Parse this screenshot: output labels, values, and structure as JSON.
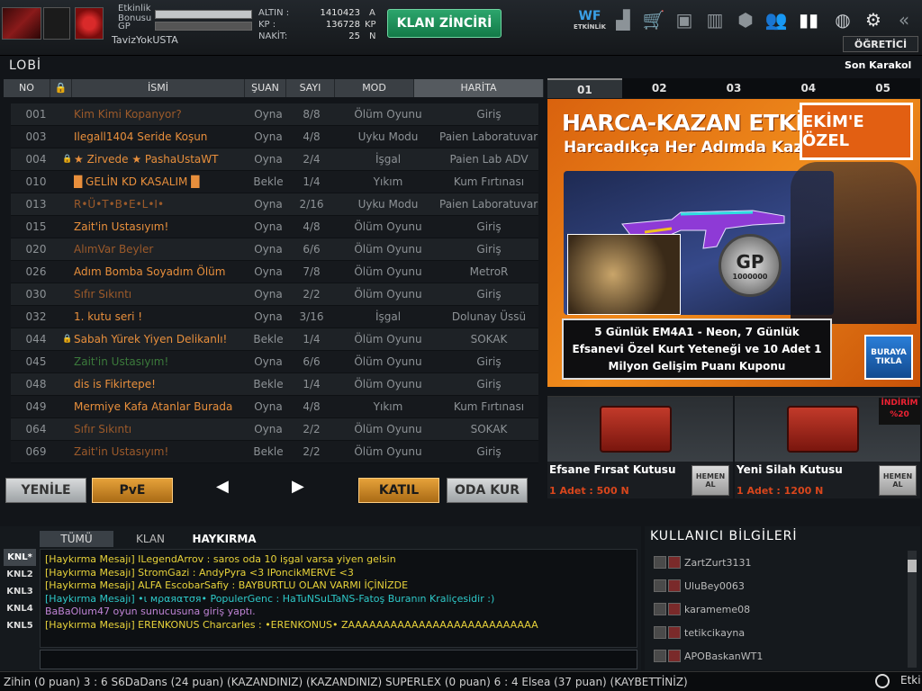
{
  "top": {
    "labels": {
      "etkinlik": "Etkinlik Bonusu",
      "gp": "GP"
    },
    "nickname": "TavizYokUSTA",
    "currency": [
      {
        "label": "ALTIN :",
        "value": "1410423",
        "unit": "A"
      },
      {
        "label": "KP :",
        "value": "136728",
        "unit": "KP"
      },
      {
        "label": "NAKİT:",
        "value": "25",
        "unit": "N"
      }
    ],
    "klan_button": "KLAN ZİNCİRİ",
    "etkinlik_icon_label": "ETKİNLİK",
    "icons": [
      "stats-icon",
      "cart-icon",
      "inventory-icon",
      "storage-icon",
      "box-icon",
      "friends-icon",
      "ranking-icon",
      "globe-icon",
      "gear-icon",
      "back-icon"
    ],
    "ogretici": "ÖĞRETİCİ"
  },
  "lobby": {
    "title": "LOBİ",
    "columns": [
      "NO",
      "",
      "İSMİ",
      "ŞUAN",
      "SAYI",
      "MOD",
      "HARİTA"
    ],
    "rows": [
      {
        "no": "001",
        "lock": "",
        "name": "Kim Kimi Kopanyor?",
        "now": "Oyna",
        "count": "8/8",
        "mod": "Ölüm Oyunu",
        "map": "Giriş",
        "style": "dim"
      },
      {
        "no": "003",
        "lock": "",
        "name": "Ilegall1404 Seride Koşun",
        "now": "Oyna",
        "count": "4/8",
        "mod": "Uyku Modu",
        "map": "Paien Laboratuvarı",
        "style": ""
      },
      {
        "no": "004",
        "lock": "🔒",
        "name": "★ Zirvede ★ PashaUstaWT",
        "now": "Oyna",
        "count": "2/4",
        "mod": "İşgal",
        "map": "Paien Lab ADV",
        "style": ""
      },
      {
        "no": "010",
        "lock": "",
        "name": "█ GELİN KD KASALIM █",
        "now": "Bekle",
        "count": "1/4",
        "mod": "Yıkım",
        "map": "Kum Fırtınası",
        "style": ""
      },
      {
        "no": "013",
        "lock": "",
        "name": "R•Ü•T•B•E•L•I•",
        "now": "Oyna",
        "count": "2/16",
        "mod": "Uyku Modu",
        "map": "Paien Laboratuvarı",
        "style": "dim"
      },
      {
        "no": "015",
        "lock": "",
        "name": "Zait'in Ustasıyım!",
        "now": "Oyna",
        "count": "4/8",
        "mod": "Ölüm Oyunu",
        "map": "Giriş",
        "style": ""
      },
      {
        "no": "020",
        "lock": "",
        "name": "AlımVar Beyler",
        "now": "Oyna",
        "count": "6/6",
        "mod": "Ölüm Oyunu",
        "map": "Giriş",
        "style": "dim"
      },
      {
        "no": "026",
        "lock": "",
        "name": "Adım Bomba Soyadım Ölüm",
        "now": "Oyna",
        "count": "7/8",
        "mod": "Ölüm Oyunu",
        "map": "MetroR",
        "style": ""
      },
      {
        "no": "030",
        "lock": "",
        "name": "Sıfır Sıkıntı",
        "now": "Oyna",
        "count": "2/2",
        "mod": "Ölüm Oyunu",
        "map": "Giriş",
        "style": "dim"
      },
      {
        "no": "032",
        "lock": "",
        "name": "1. kutu seri !",
        "now": "Oyna",
        "count": "3/16",
        "mod": "İşgal",
        "map": "Dolunay Üssü",
        "style": ""
      },
      {
        "no": "044",
        "lock": "🔒",
        "name": "Sabah Yürek Yiyen Delikanlı!",
        "now": "Bekle",
        "count": "1/4",
        "mod": "Ölüm Oyunu",
        "map": "SOKAK",
        "style": ""
      },
      {
        "no": "045",
        "lock": "",
        "name": "Zait'in Ustasıyım!",
        "now": "Oyna",
        "count": "6/6",
        "mod": "Ölüm Oyunu",
        "map": "Giriş",
        "style": "green"
      },
      {
        "no": "048",
        "lock": "",
        "name": "dis is Fikirtepe!",
        "now": "Bekle",
        "count": "1/4",
        "mod": "Ölüm Oyunu",
        "map": "Giriş",
        "style": ""
      },
      {
        "no": "049",
        "lock": "",
        "name": "Mermiye Kafa Atanlar Burada",
        "now": "Oyna",
        "count": "4/8",
        "mod": "Yıkım",
        "map": "Kum Fırtınası",
        "style": ""
      },
      {
        "no": "064",
        "lock": "",
        "name": "Sıfır Sıkıntı",
        "now": "Oyna",
        "count": "2/2",
        "mod": "Ölüm Oyunu",
        "map": "SOKAK",
        "style": "dim"
      },
      {
        "no": "069",
        "lock": "",
        "name": "Zait'in Ustasıyım!",
        "now": "Bekle",
        "count": "2/2",
        "mod": "Ölüm Oyunu",
        "map": "Giriş",
        "style": "dim"
      }
    ],
    "buttons": {
      "yenile": "YENİLE",
      "pve": "PvE",
      "katil": "KATIL",
      "oda_kur": "ODA KUR",
      "prev": "◀",
      "next": "▶"
    }
  },
  "right": {
    "son_karakol": "Son Karakol",
    "tabs": [
      "01",
      "02",
      "03",
      "04",
      "05"
    ],
    "banner": {
      "title": "HARCA-KAZAN ETKİNLİĞİ",
      "subtitle": "Harcadıkça Her Adımda Kazan!",
      "badge": "EKİM'E ÖZEL",
      "gp_value": "1000000",
      "gp_label": "GP",
      "description": "5 Günlük EM4A1 - Neon, 7 Günlük Efsanevi Özel Kurt Yeteneği ve 10 Adet 1 Milyon Gelişim Puanı Kuponu",
      "button": "BURAYA TIKLA"
    },
    "shop": [
      {
        "name": "Efsane Fırsat Kutusu",
        "price": "1 Adet : 500 N",
        "buy": "HEMEN AL"
      },
      {
        "name": "Yeni Silah Kutusu",
        "price": "1 Adet : 1200 N",
        "buy": "HEMEN AL"
      }
    ],
    "discount": "İNDİRİM %20"
  },
  "chat": {
    "tabs": [
      "TÜMÜ",
      "KLAN",
      "HAYKIRMA"
    ],
    "channels": [
      "KNL*",
      "KNL2",
      "KNL3",
      "KNL4",
      "KNL5"
    ],
    "messages": [
      {
        "text": "[Haykırma Mesajı] ILegendArrov : saros oda 10 işgal varsa yiyen gelsin",
        "color": "y"
      },
      {
        "text": "[Haykırma Mesajı] StromGazi : AndyPyra <3 IPoncikMERVE <3",
        "color": "y"
      },
      {
        "text": "[Haykırma Mesajı] ALFA EscobarSafiy : BAYBURTLU OLAN VARMI İÇİNİZDE",
        "color": "y"
      },
      {
        "text": "[Haykırma Mesajı] •ι мραяατσя• PopulerGenc : HaTuNSuLTaNS-Fatoş Buranın Kraliçesidir :)",
        "color": "c"
      },
      {
        "text": "BaBaOlum47 oyun sunucusuna giriş yaptı.",
        "color": "p"
      },
      {
        "text": "[Haykırma Mesajı] ERENKONUS Charcarles : •ERENKONUS• ZAAAAAAAAAAAAAAAAAAAAAAAAAAA",
        "color": "y"
      }
    ]
  },
  "users": {
    "title": "KULLANICI BİLGİLERİ",
    "list": [
      "ZartZurt3131",
      "UluBey0063",
      "karameme08",
      "tetikcikayna",
      "APOBaskanWT1"
    ]
  },
  "ticker": {
    "text": "Zihin (0 puan) 3 : 6 S6DaDans (24 puan) (KAZANDINIZ)      (KAZANDINIZ) SUPERLEX (0 puan) 6 : 4 Elsea (37 puan) (KAYBETTİNİZ)",
    "end": "Etki"
  }
}
